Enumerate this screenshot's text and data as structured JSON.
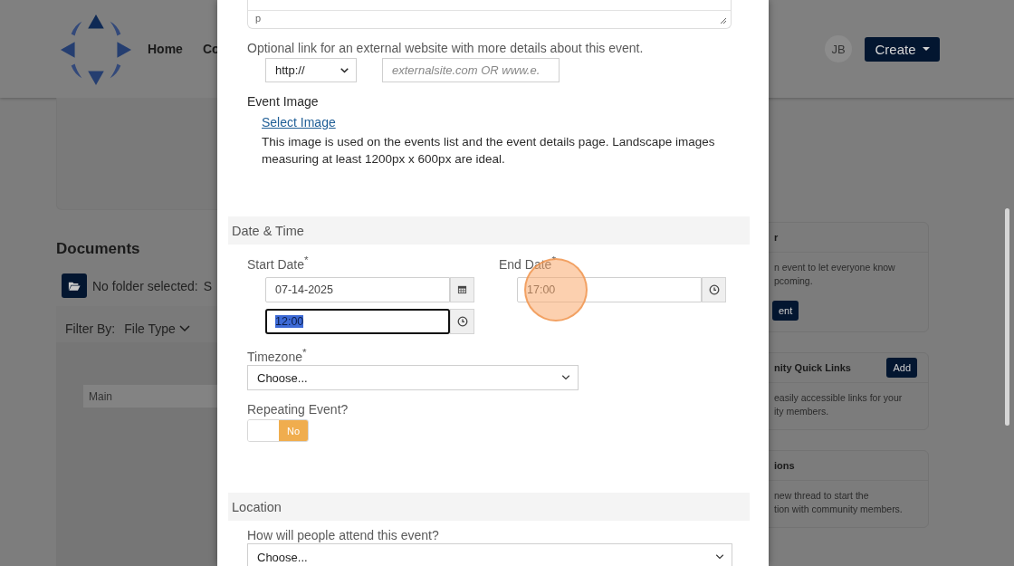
{
  "header": {
    "nav": [
      {
        "label": "Home"
      },
      {
        "label": "Co"
      }
    ],
    "avatar": "JB",
    "create_button": "Create"
  },
  "documents": {
    "title": "Documents",
    "folder_text": "No folder selected:",
    "folder_text_cut": "S",
    "filter_label": "Filter By:",
    "filter_value": "File Type",
    "folders": [
      "Main"
    ]
  },
  "side_cards": [
    {
      "title": "r",
      "lines": [
        "n event to let everyone know",
        "pcoming."
      ],
      "button": "ent"
    },
    {
      "title": "nity Quick Links",
      "header_button": "Add",
      "lines": [
        "easily accessible links for your",
        "ity members."
      ]
    },
    {
      "title": "ions",
      "lines": [
        "new thread to start the",
        "tion with community members."
      ]
    }
  ],
  "modal": {
    "editor_status": "p",
    "link": {
      "label": "Optional link for an external website with more details about this event.",
      "protocol": "http://",
      "placeholder": "externalsite.com OR www.e."
    },
    "image": {
      "label": "Event Image",
      "link": "Select Image",
      "help": "This image is used on the events list and the event details page. Landscape images measuring at least 1200px x 600px are ideal."
    },
    "date_time": {
      "title": "Date & Time",
      "start_label": "Start Date$^{*}$",
      "end_label": "End Date$^{*}$",
      "start_date": "07-14-2025",
      "start_time": "12:00",
      "start_time_focused": true,
      "end_time": "17:00",
      "timezone_label": "Timezone$^{*}$",
      "timezone": "Choose...",
      "repeating_label": "Repeating Event?",
      "repeating": {
        "on": false,
        "label": "No"
      }
    },
    "location": {
      "title": "Location",
      "attend_label": "How will people attend this event?",
      "attend": "Choose..."
    }
  }
}
